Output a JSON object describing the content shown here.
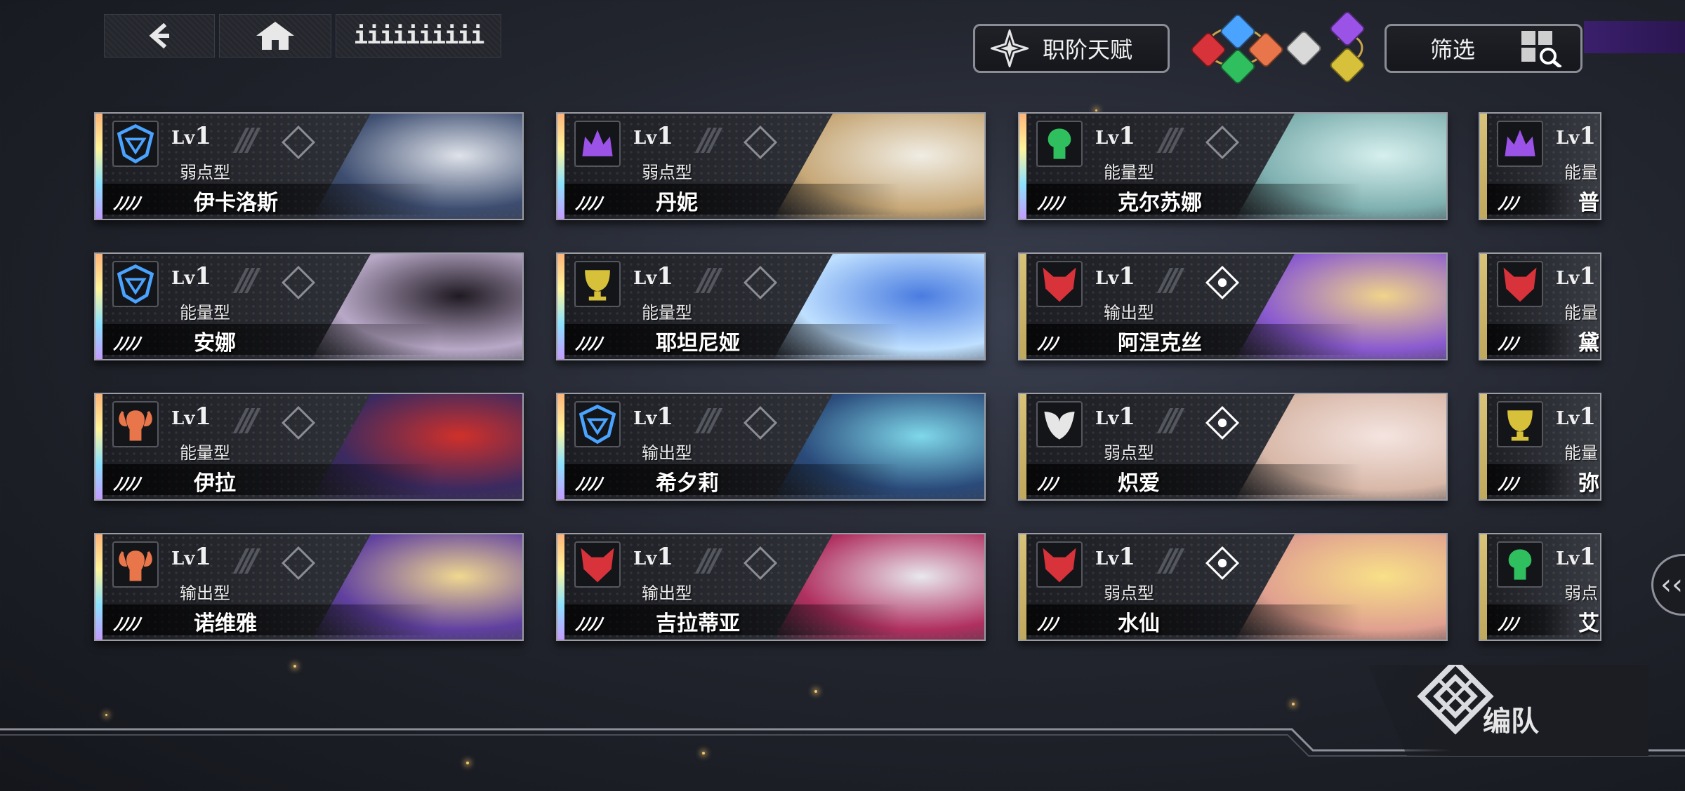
{
  "nav": {
    "back_icon": "chevron-left-icon",
    "home_icon": "home-icon",
    "crumb": "iiiiiiiiii"
  },
  "toolbar": {
    "talent_label": "职阶天赋",
    "filter_label": "筛选"
  },
  "faction_icons": [
    "wolf-red",
    "shield-blue",
    "ram-orange",
    "tree-green",
    "wing-white",
    "crown-purple",
    "trophy-yellow"
  ],
  "cards": [
    {
      "emblem": "shield-blue",
      "lv_prefix": "Lv",
      "lv": "1",
      "type": "弱点型",
      "stars": "ﾉﾉﾉﾉ",
      "name": "伊卡洛斯",
      "active_gem": false
    },
    {
      "emblem": "crown-purple",
      "lv_prefix": "Lv",
      "lv": "1",
      "type": "弱点型",
      "stars": "ﾉﾉﾉﾉ",
      "name": "丹妮",
      "active_gem": false
    },
    {
      "emblem": "tree-green",
      "lv_prefix": "Lv",
      "lv": "1",
      "type": "能量型",
      "stars": "ﾉﾉﾉﾉ",
      "name": "克尔苏娜",
      "active_gem": false
    },
    {
      "emblem": "crown-purple",
      "lv_prefix": "Lv",
      "lv": "1",
      "type": "能量",
      "stars": "ﾉﾉﾉ",
      "name": "普",
      "active_gem": false
    },
    {
      "emblem": "shield-blue",
      "lv_prefix": "Lv",
      "lv": "1",
      "type": "能量型",
      "stars": "ﾉﾉﾉﾉ",
      "name": "安娜",
      "active_gem": false
    },
    {
      "emblem": "trophy-yellow",
      "lv_prefix": "Lv",
      "lv": "1",
      "type": "能量型",
      "stars": "ﾉﾉﾉﾉ",
      "name": "耶坦尼娅",
      "active_gem": false
    },
    {
      "emblem": "wolf-red",
      "lv_prefix": "Lv",
      "lv": "1",
      "type": "输出型",
      "stars": "ﾉﾉﾉ",
      "name": "阿涅克丝",
      "active_gem": true
    },
    {
      "emblem": "wolf-red",
      "lv_prefix": "Lv",
      "lv": "1",
      "type": "能量",
      "stars": "ﾉﾉﾉ",
      "name": "黛",
      "active_gem": false
    },
    {
      "emblem": "ram-orange",
      "lv_prefix": "Lv",
      "lv": "1",
      "type": "能量型",
      "stars": "ﾉﾉﾉﾉ",
      "name": "伊拉",
      "active_gem": false
    },
    {
      "emblem": "shield-blue",
      "lv_prefix": "Lv",
      "lv": "1",
      "type": "输出型",
      "stars": "ﾉﾉﾉﾉ",
      "name": "希夕莉",
      "active_gem": false
    },
    {
      "emblem": "wing-white",
      "lv_prefix": "Lv",
      "lv": "1",
      "type": "弱点型",
      "stars": "ﾉﾉﾉ",
      "name": "炽爱",
      "active_gem": true
    },
    {
      "emblem": "trophy-yellow",
      "lv_prefix": "Lv",
      "lv": "1",
      "type": "能量",
      "stars": "ﾉﾉﾉ",
      "name": "弥",
      "active_gem": false
    },
    {
      "emblem": "ram-orange",
      "lv_prefix": "Lv",
      "lv": "1",
      "type": "输出型",
      "stars": "ﾉﾉﾉﾉ",
      "name": "诺维雅",
      "active_gem": false
    },
    {
      "emblem": "wolf-red",
      "lv_prefix": "Lv",
      "lv": "1",
      "type": "输出型",
      "stars": "ﾉﾉﾉﾉ",
      "name": "吉拉蒂亚",
      "active_gem": false
    },
    {
      "emblem": "wolf-red",
      "lv_prefix": "Lv",
      "lv": "1",
      "type": "弱点型",
      "stars": "ﾉﾉﾉ",
      "name": "水仙",
      "active_gem": true
    },
    {
      "emblem": "tree-green",
      "lv_prefix": "Lv",
      "lv": "1",
      "type": "弱点",
      "stars": "ﾉﾉﾉ",
      "name": "艾",
      "active_gem": false
    }
  ],
  "formation": {
    "label": "编队",
    "icon": "formation-knot-icon"
  },
  "side_tab_icon": "double-chevron-left-icon",
  "colors": {
    "shield-blue": "#4aa3ff",
    "crown-purple": "#9b52e6",
    "tree-green": "#2fbf5f",
    "trophy-yellow": "#d8c13a",
    "wolf-red": "#d8323b",
    "ram-orange": "#e8764a",
    "wing-white": "#e6e6e6"
  }
}
